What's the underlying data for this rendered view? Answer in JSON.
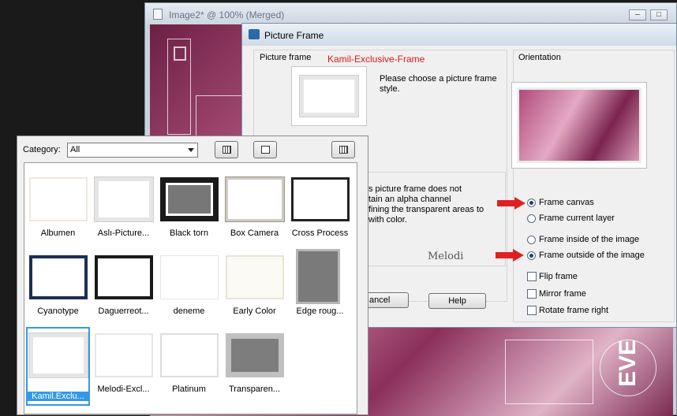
{
  "image_window": {
    "title": "Image2* @ 100% (Merged)",
    "buttons": [
      "–",
      "□"
    ]
  },
  "picture_frame_dialog": {
    "title": "Picture Frame",
    "picture_frame_label": "Picture frame",
    "frame_name": "Kamil-Exclusive-Frame",
    "choose_text": "Please choose a picture frame style.",
    "info_lines": [
      "s picture frame does not",
      "tain an alpha channel",
      "fining the transparent areas to",
      "with color."
    ],
    "cancel_label": "ancel",
    "help_label": "Help",
    "watermark": "Melodi",
    "orientation_label": "Orientation",
    "options": {
      "frame_canvas": {
        "label": "Frame canvas",
        "checked": true
      },
      "frame_current_layer": {
        "label": "Frame current layer",
        "checked": false
      },
      "frame_inside": {
        "label": "Frame inside of the image",
        "checked": false
      },
      "frame_outside": {
        "label": "Frame outside of the image",
        "checked": true
      },
      "flip_frame": {
        "label": "Flip frame",
        "checked": false
      },
      "mirror_frame": {
        "label": "Mirror frame",
        "checked": false
      },
      "rotate_frame_right": {
        "label": "Rotate frame right",
        "checked": false
      }
    }
  },
  "frame_picker": {
    "category_label": "Category:",
    "category_value": "All",
    "items": [
      {
        "label": "Albumen"
      },
      {
        "label": "Aslı-Picture..."
      },
      {
        "label": "Black torn"
      },
      {
        "label": "Box Camera"
      },
      {
        "label": "Cross Process"
      },
      {
        "label": "Cyanotype"
      },
      {
        "label": "Daguerreot..."
      },
      {
        "label": "deneme"
      },
      {
        "label": "Early Color"
      },
      {
        "label": "Edge roug..."
      },
      {
        "label": "Kamil.Exclu...",
        "selected": true
      },
      {
        "label": "Melodi-Excl..."
      },
      {
        "label": "Platinum"
      },
      {
        "label": "Transparen..."
      }
    ]
  },
  "colors": {
    "highlight": "#3399e6",
    "annotation_red": "#e01818",
    "arrow_red": "#e02020"
  }
}
